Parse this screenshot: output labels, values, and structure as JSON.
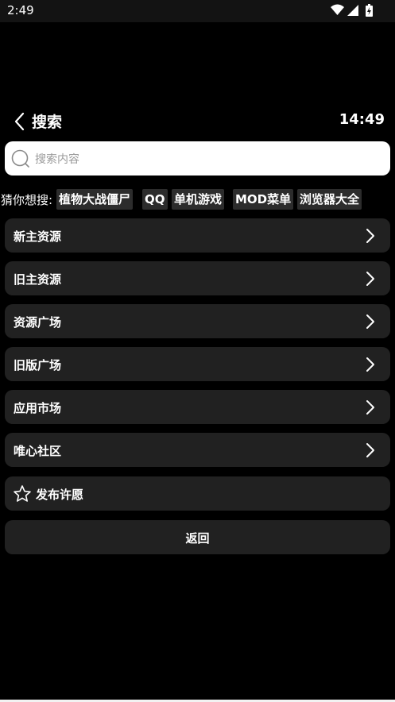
{
  "status_bar": {
    "time": "2:49",
    "icons": [
      "wifi-icon",
      "signal-icon",
      "battery-icon"
    ]
  },
  "header": {
    "title": "搜索",
    "clock": "14:49",
    "back_icon": "back-arrow-icon"
  },
  "search": {
    "placeholder": "搜索内容",
    "value": ""
  },
  "suggestions": {
    "label": "猜你想搜:",
    "chips": [
      "植物大战僵尸",
      "QQ",
      "单机游戏",
      "MOD菜单",
      "浏览器大全"
    ]
  },
  "menu": {
    "items": [
      {
        "label": "新主资源"
      },
      {
        "label": "旧主资源"
      },
      {
        "label": "资源广场"
      },
      {
        "label": "旧版广场"
      },
      {
        "label": "应用市场"
      },
      {
        "label": "唯心社区"
      }
    ]
  },
  "wish": {
    "label": "发布许愿",
    "icon": "star-icon"
  },
  "return_button": {
    "label": "返回"
  },
  "colors": {
    "background": "#000000",
    "card": "#212121",
    "chip": "#2c2c2c",
    "search_bg": "#ffffff"
  }
}
